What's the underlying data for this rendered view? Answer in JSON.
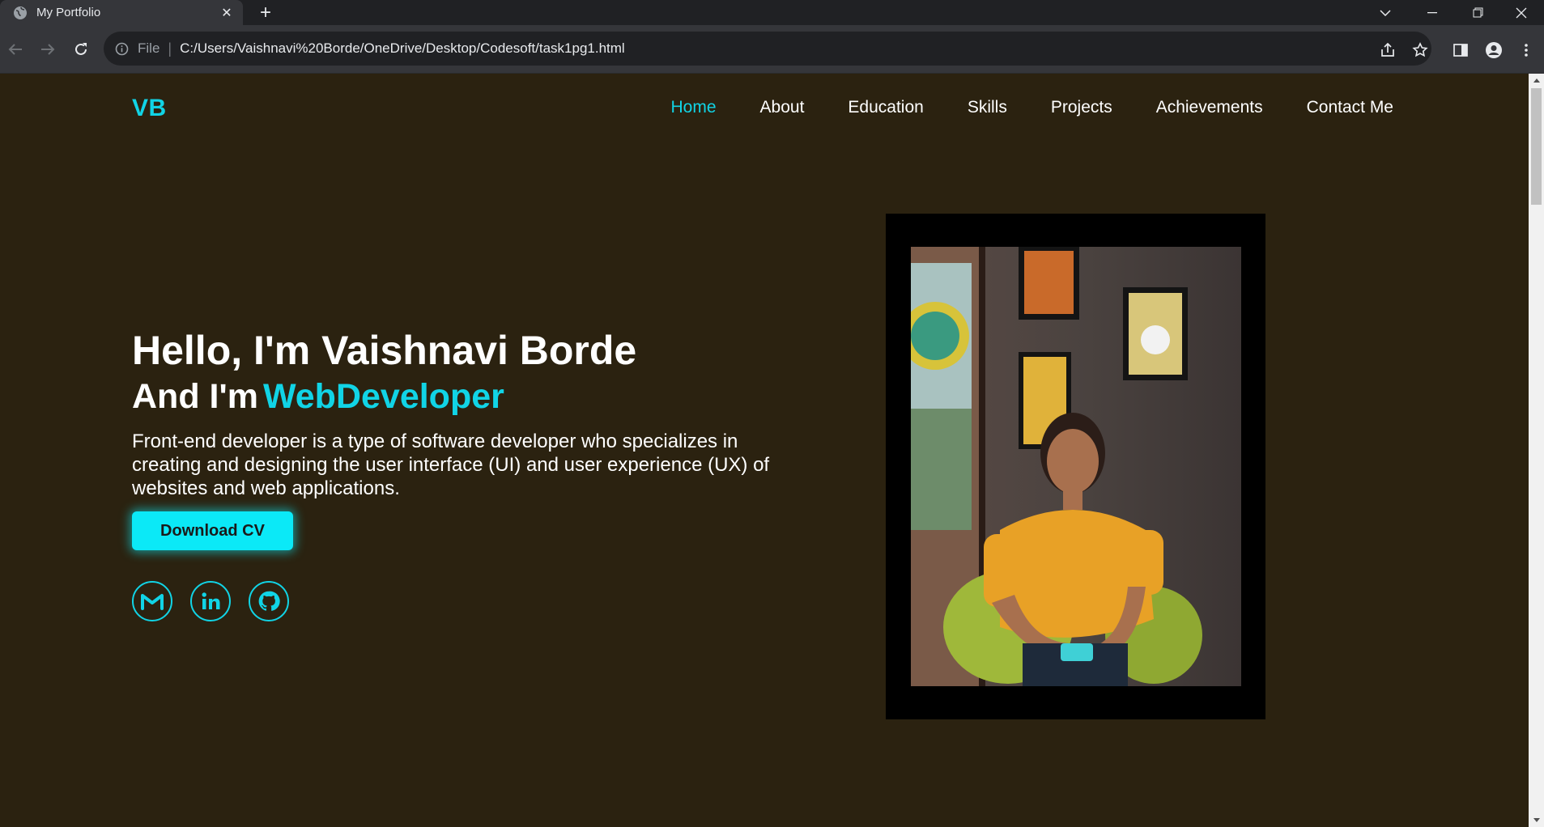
{
  "browser": {
    "tab_title": "My Portfolio",
    "address_scheme": "File",
    "address_url": "C:/Users/Vaishnavi%20Borde/OneDrive/Desktop/Codesoft/task1pg1.html"
  },
  "site": {
    "logo": "VB",
    "nav": [
      {
        "label": "Home",
        "active": true
      },
      {
        "label": "About"
      },
      {
        "label": "Education"
      },
      {
        "label": "Skills"
      },
      {
        "label": "Projects"
      },
      {
        "label": "Achievements"
      },
      {
        "label": "Contact Me"
      }
    ]
  },
  "hero": {
    "greeting": "Hello, I'm Vaishnavi Borde",
    "role_prefix": "And I'm",
    "role": "WebDeveloper",
    "description": "Front-end developer is a type of software developer who specializes in creating and designing the user interface (UI) and user experience (UX) of websites and web applications.",
    "cv_button": "Download CV",
    "social_icons": [
      "gmail-icon",
      "linkedin-icon",
      "github-icon"
    ]
  },
  "colors": {
    "accent": "#11d4e6",
    "background": "#2b2210",
    "button": "#0be9f7"
  }
}
